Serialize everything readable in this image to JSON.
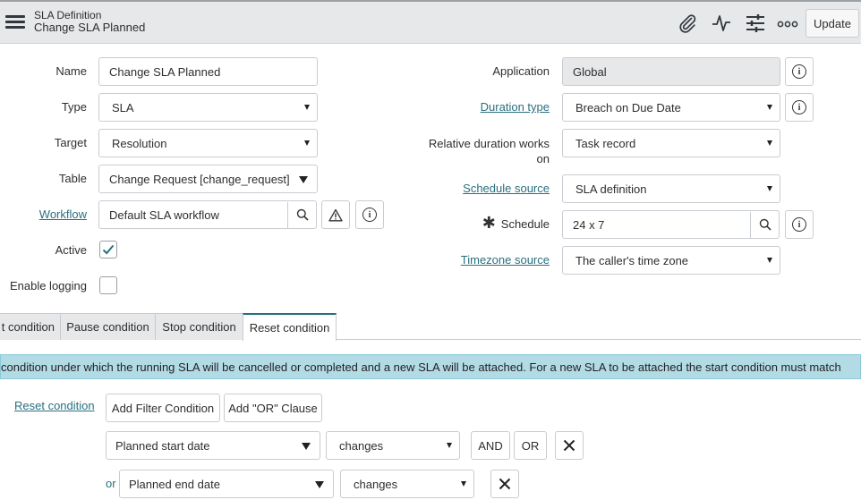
{
  "header": {
    "title_line1": "SLA Definition",
    "title_line2": "Change SLA Planned",
    "icons": [
      "hamburger-menu-icon",
      "paperclip-icon",
      "activity-icon",
      "settings-sliders-icon",
      "more-options-icon"
    ],
    "update_label": "Update"
  },
  "form": {
    "name": {
      "label": "Name",
      "value": "Change SLA Planned"
    },
    "type": {
      "label": "Type",
      "value": "SLA"
    },
    "target": {
      "label": "Target",
      "value": "Resolution"
    },
    "table": {
      "label": "Table",
      "value": "Change Request [change_request]"
    },
    "workflow": {
      "label": "Workflow",
      "value": "Default SLA workflow"
    },
    "active": {
      "label": "Active",
      "checked": true
    },
    "enable_logging": {
      "label": "Enable logging",
      "checked": false
    },
    "application": {
      "label": "Application",
      "value": "Global"
    },
    "duration_type": {
      "label": "Duration type",
      "value": "Breach on Due Date"
    },
    "relative_duration": {
      "label_line1": "Relative duration works",
      "label_line2": "on",
      "value": "Task record"
    },
    "schedule_source": {
      "label": "Schedule source",
      "value": "SLA definition"
    },
    "schedule": {
      "label": "Schedule",
      "value": "24 x 7",
      "mandatory_mark": "✱"
    },
    "timezone_source": {
      "label": "Timezone source",
      "value": "The caller's time zone"
    }
  },
  "tabs": [
    {
      "label": "t condition"
    },
    {
      "label": "Pause condition"
    },
    {
      "label": "Stop condition"
    },
    {
      "label": "Reset condition",
      "active": true
    }
  ],
  "banner": {
    "text": "condition under which the running SLA will be cancelled or completed and a new SLA will be attached. For a new SLA to be attached the start condition must match"
  },
  "condition_builder": {
    "label": "Reset condition",
    "add_filter_label": "Add Filter Condition",
    "add_or_label": "Add \"OR\" Clause",
    "rows": [
      {
        "prefix": "",
        "field": "Planned start date",
        "operator": "changes",
        "and_label": "AND",
        "or_label": "OR"
      },
      {
        "prefix": "or",
        "field": "Planned end date",
        "operator": "changes"
      }
    ]
  },
  "colors": {
    "header_bg": "#e6e8ea",
    "link": "#2a6f7f",
    "banner_bg": "#b2dbe6",
    "check": "#2a6f7f"
  }
}
